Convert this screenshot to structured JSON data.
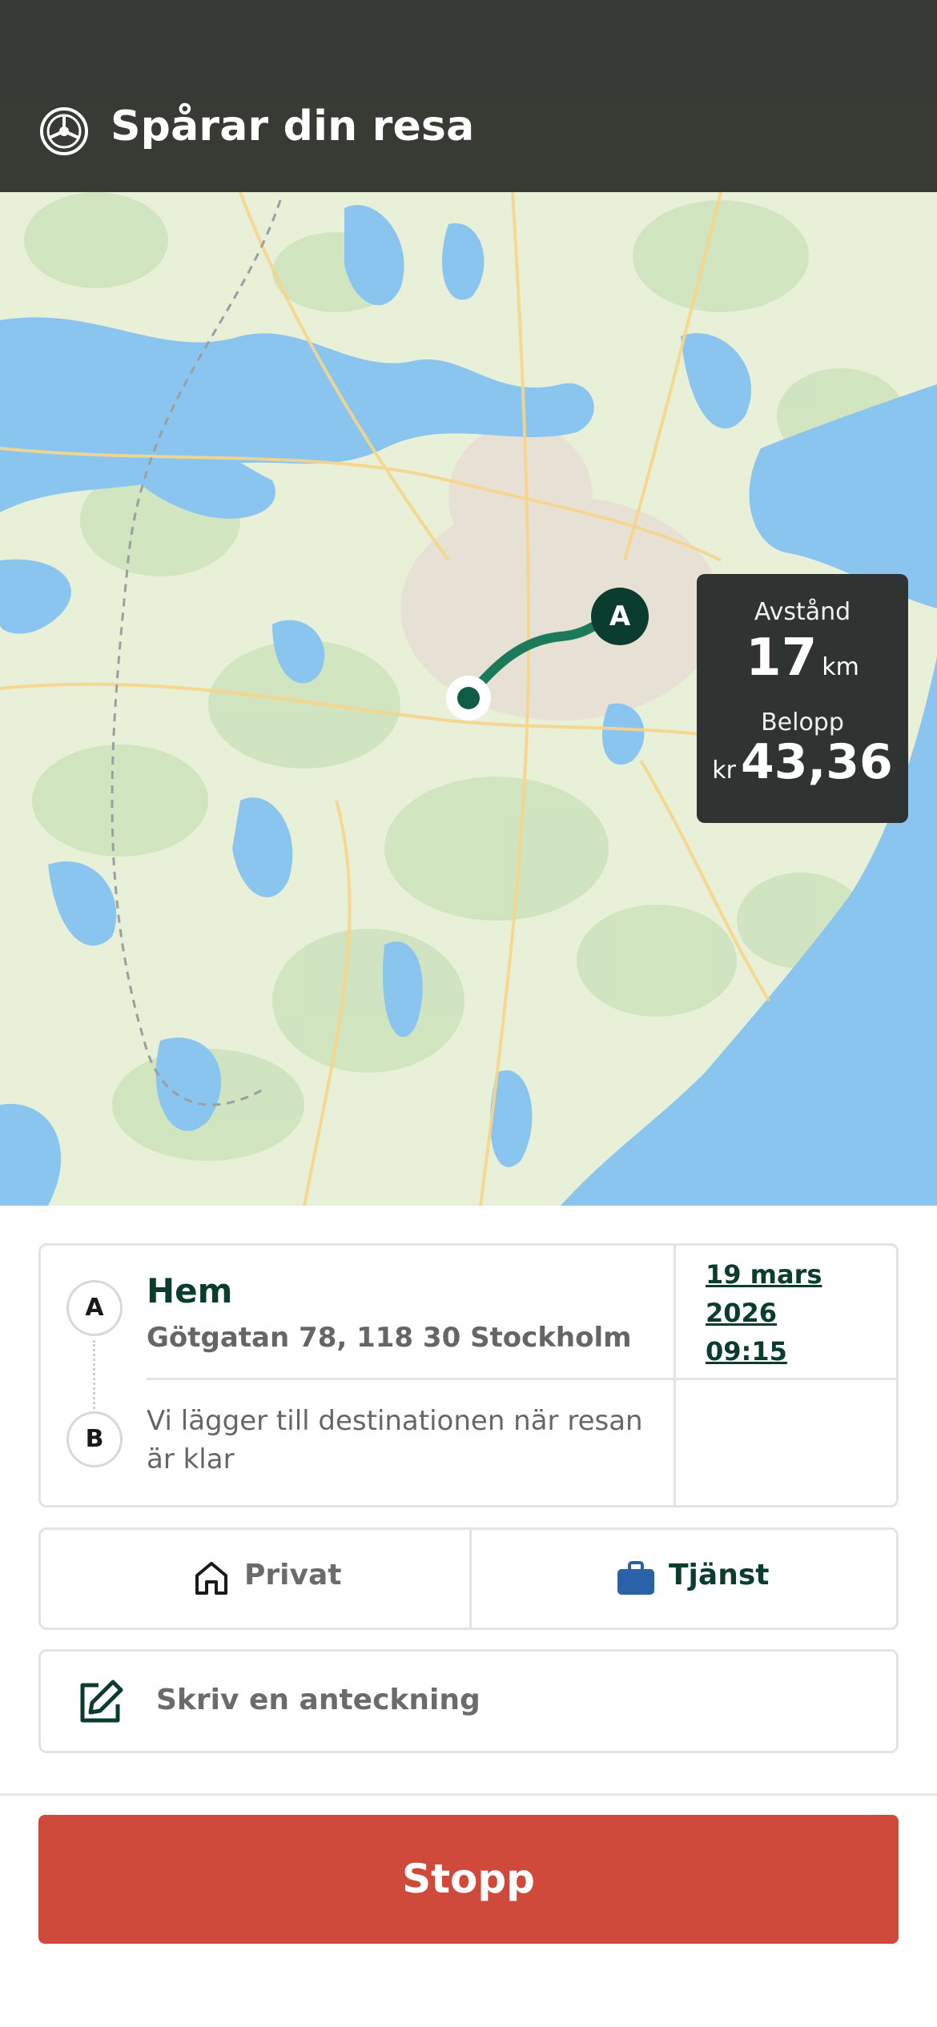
{
  "header": {
    "title": "Spårar din resa"
  },
  "map": {
    "start_marker_label": "A"
  },
  "stats": {
    "distance_label": "Avstånd",
    "distance_value": "17",
    "distance_unit": "km",
    "amount_label": "Belopp",
    "amount_currency": "kr",
    "amount_value": "43,36"
  },
  "trip": {
    "start_label": "A",
    "end_label": "B",
    "start_name": "Hem",
    "start_address": "Götgatan 78, 118 30 Stockholm",
    "destination_note": "Vi lägger till destinationen när resan är klar",
    "date_line1": "19 mars",
    "date_line2": "2026",
    "time": "09:15"
  },
  "trip_type": {
    "private_label": "Privat",
    "work_label": "Tjänst",
    "selected": "Tjänst"
  },
  "note": {
    "placeholder": "Skriv en anteckning"
  },
  "actions": {
    "stop_label": "Stopp"
  },
  "colors": {
    "brand_dark_green": "#0b3d2e",
    "route_green": "#1b7a5a",
    "stop_red": "#cf4a3a",
    "water": "#8ac5f0",
    "land": "#e9f0d8",
    "briefcase_blue": "#2a62a8"
  }
}
